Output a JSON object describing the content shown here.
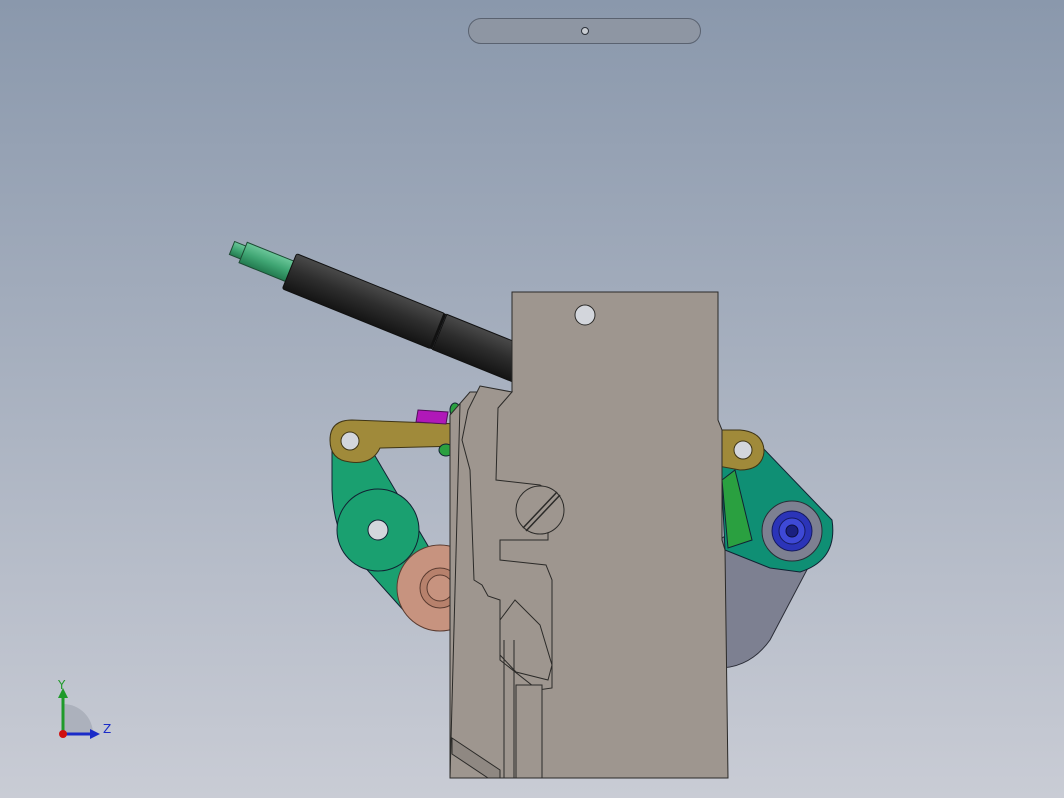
{
  "viewport": {
    "background_top": "#8a98ac",
    "background_bottom": "#c9ccd5"
  },
  "toolbar": {
    "handle_icon": "circle-handle-icon"
  },
  "triad": {
    "y_label": "Y",
    "z_label": "Z",
    "colors": {
      "y": "#1f9a2a",
      "z": "#1a2bc8",
      "x": "#d01010"
    }
  },
  "parts": {
    "housing": "#9e968f",
    "link_olive": "#a08a3a",
    "arm_green": "#1aa070",
    "arm_teal": "#0f8f74",
    "roller_tan": "#c7937f",
    "rod_black": "#2d2d2d",
    "tip_green": "#3fa573",
    "arm_grey": "#7d8091",
    "gear_blue": "#2b34b8",
    "accent_magenta": "#b018b8"
  }
}
